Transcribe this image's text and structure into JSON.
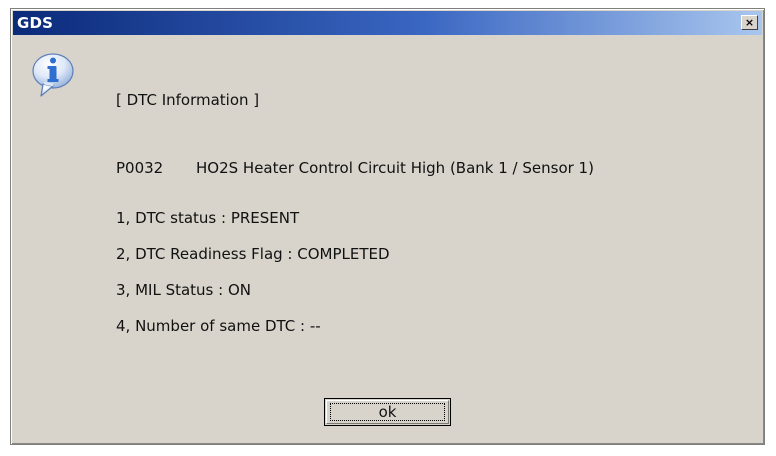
{
  "window": {
    "title": "GDS",
    "close_label": "×"
  },
  "icon": {
    "name": "info-icon",
    "glyph": "i"
  },
  "dialog": {
    "header": "[ DTC Information ]",
    "dtc_code": "P0032",
    "dtc_description": "HO2S Heater Control Circuit High (Bank 1 / Sensor 1)",
    "items": [
      "1, DTC status : PRESENT",
      "2, DTC Readiness Flag : COMPLETED",
      "3, MIL Status : ON",
      "4, Number of same DTC : --"
    ]
  },
  "buttons": {
    "ok_label": "ok"
  },
  "colors": {
    "dialog_bg": "#d8d4cc",
    "title_gradient_start": "#0b2a7a",
    "title_gradient_end": "#a9c6ee",
    "icon_blue": "#2f6fd0"
  }
}
